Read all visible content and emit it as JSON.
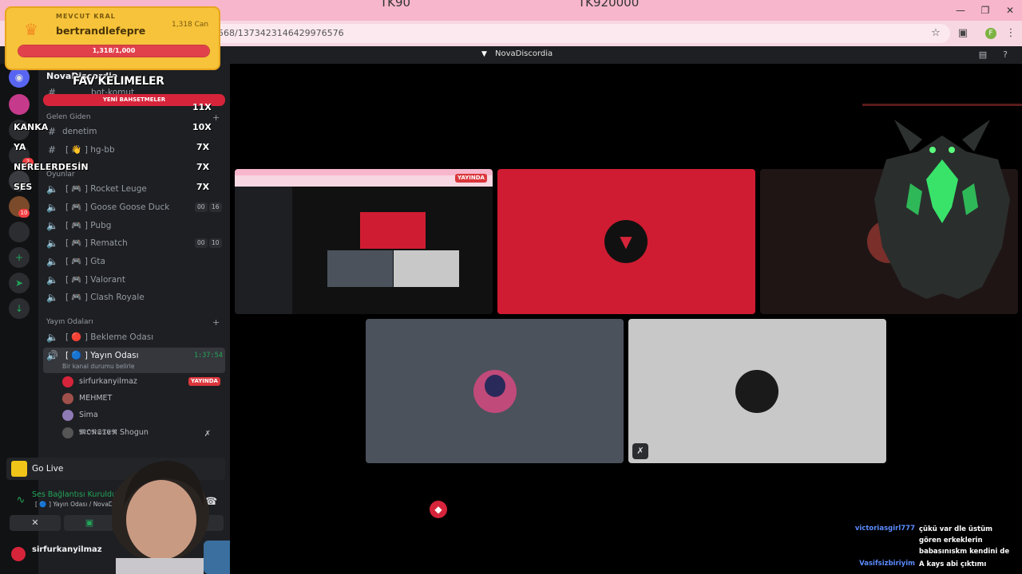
{
  "browser": {
    "tab_amount_left": "TK90",
    "tab_amount_right": "TK920000",
    "url": "568/1373423146429976576",
    "profile_initial": "F"
  },
  "discord": {
    "title": "NovaDiscordia",
    "server_name": "NovaDiscordia",
    "guild_badges": [
      "2",
      "10"
    ],
    "truncated_channel": "bot-komut",
    "categories": {
      "gelen_giden": "Gelen Giden",
      "oyunlar": "Oyunlar",
      "yayin_odalari": "Yayın Odaları"
    },
    "text_channels": [
      {
        "label": "denetim",
        "icon": "hash-icon"
      },
      {
        "label": "[ 👋 ]  hg-bb",
        "icon": "hash-icon"
      }
    ],
    "game_channels": [
      {
        "label": "[ 🎮 ]  Rocket Leuge",
        "count": ""
      },
      {
        "label": "[ 🎮 ]  Goose Goose Duck",
        "count_a": "00",
        "count_b": "16"
      },
      {
        "label": "[ 🎮 ]  Pubg",
        "count": ""
      },
      {
        "label": "[ 🎮 ]  Rematch",
        "count_a": "00",
        "count_b": "10"
      },
      {
        "label": "[ 🎮 ]  Gta",
        "count": ""
      },
      {
        "label": "[ 🎮 ]  Valorant",
        "count": ""
      },
      {
        "label": "[ 🎮 ]  Clash Royale",
        "count": ""
      }
    ],
    "stream_channels": [
      {
        "label": "[ 🔴 ]  Bekleme Odası"
      },
      {
        "label": "[ 🔵 ]  Yayın Odası"
      }
    ],
    "timer": "1:37:54",
    "channel_status": "Bir kanal durumu belirle",
    "members": [
      {
        "name": "sirfurkanyilmaz",
        "live": "YAYINDA"
      },
      {
        "name": "MEHMET"
      },
      {
        "name": "Sima"
      },
      {
        "name": "𝕸𝕺𝕹𝕾𝕿𝕰𝕽 Shogun"
      }
    ],
    "go_live": "Go Live",
    "voice_status": "Ses Bağlantısı Kuruldu",
    "voice_sub": "[ 🔵 ]  Yayın Odası / NovaDiscordia",
    "user_name": "sirfurkanyilmaz",
    "live_tag": "YAYINDA"
  },
  "overlay": {
    "king_label": "MEVCUT KRAL",
    "king_name": "bertrandlefepre",
    "king_can": "1,318 Can",
    "king_progress": "1,318/1,000",
    "king_fill_fraction": 1.0,
    "fav_title": "FAV KELIMELER",
    "fav_bar": "YENİ BAHSETMELER",
    "fav_words": [
      {
        "word": "KANKA",
        "count": "11X"
      },
      {
        "word": "",
        "count": "10X"
      },
      {
        "word": "YA",
        "count": "7X"
      },
      {
        "word": "NERELERDESİN",
        "count": "7X"
      },
      {
        "word": "SES",
        "count": "7X"
      }
    ]
  },
  "chat": [
    {
      "user": "victoriasgirl777",
      "text": "çükü var dle üstüm gören erkeklerin babasınıskm kendini de"
    },
    {
      "user": "Vasifsizbiriyim",
      "text": "A kays abi çıktımı"
    }
  ],
  "colors": {
    "discord_red": "#d6243a",
    "tile_red": "#cf1c32",
    "tile_slate": "#4b525c",
    "tile_light": "#c8c8c8",
    "online_green": "#23a55a",
    "chat_blue": "#5b8cff"
  }
}
